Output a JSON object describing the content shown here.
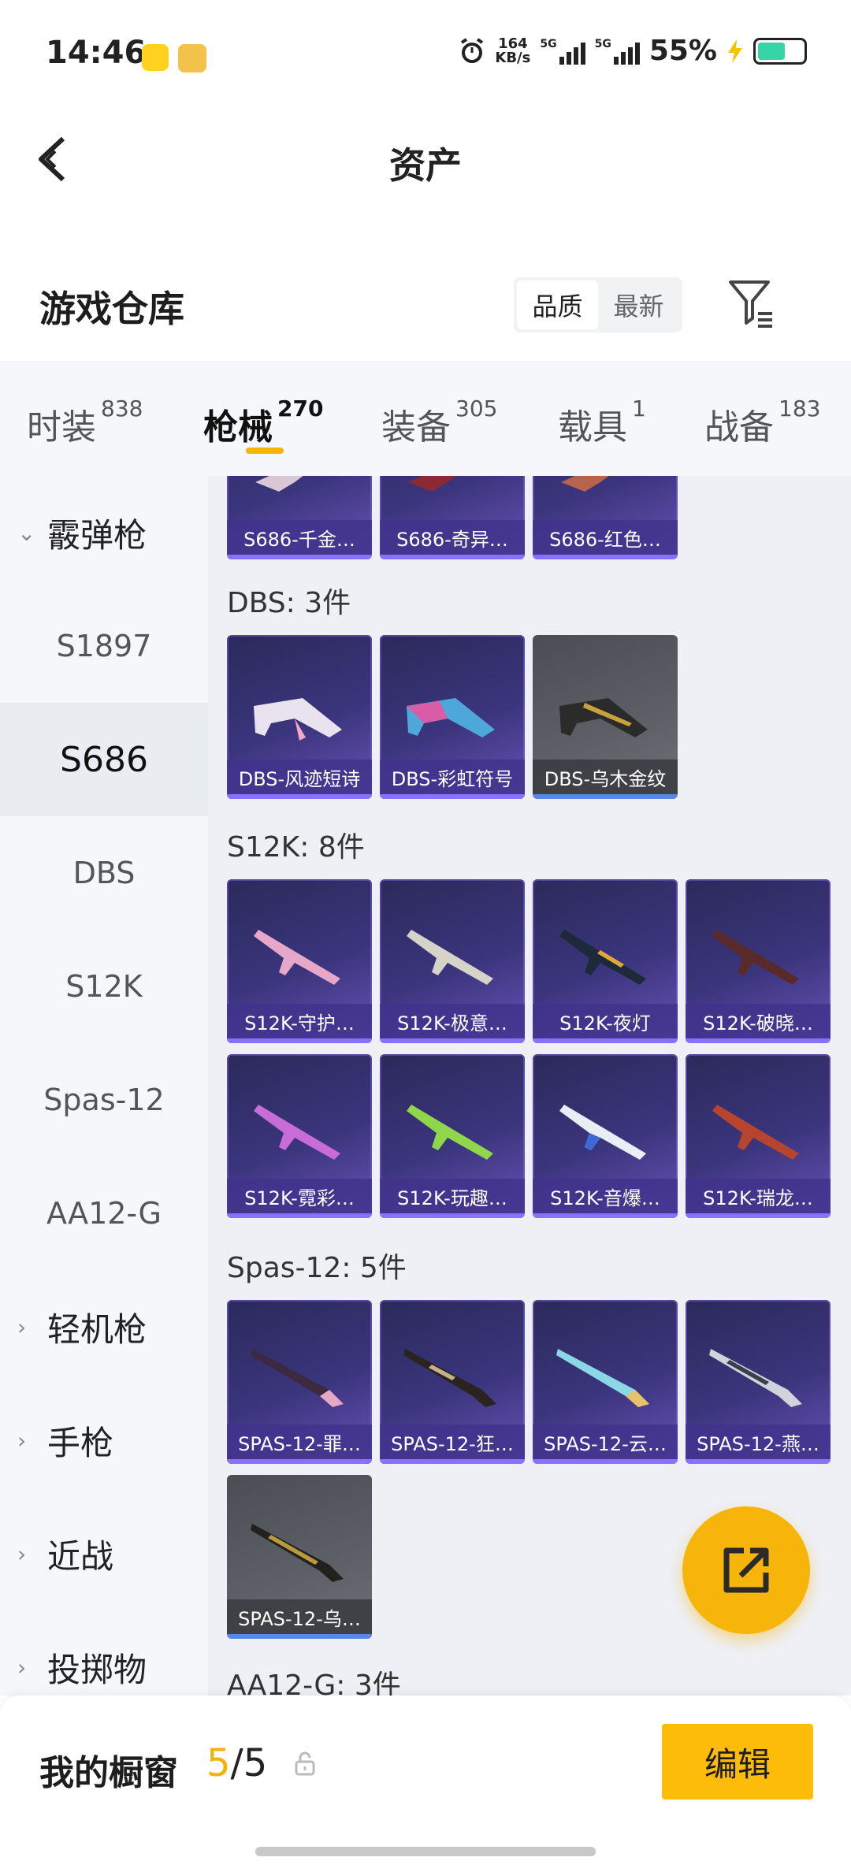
{
  "status": {
    "time": "14:46",
    "speed": "164",
    "speed_unit": "KB/s",
    "net1": "5G",
    "net2": "5G",
    "battery": "55%"
  },
  "header": {
    "title": "资产"
  },
  "repo": {
    "title": "游戏仓库",
    "sort_quality": "品质",
    "sort_latest": "最新"
  },
  "tabs": [
    {
      "label": "时装",
      "count": "838"
    },
    {
      "label": "枪械",
      "count": "270"
    },
    {
      "label": "装备",
      "count": "305"
    },
    {
      "label": "载具",
      "count": "1"
    },
    {
      "label": "战备",
      "count": "183"
    }
  ],
  "sidebar": {
    "category_shotgun": "霰弹枪",
    "items": [
      "S1897",
      "S686",
      "DBS",
      "S12K",
      "Spas-12",
      "AA12-G"
    ],
    "selected": "S686",
    "cat_lmg": "轻机枪",
    "cat_pistol": "手枪",
    "cat_melee": "近战",
    "cat_throw": "投掷物"
  },
  "content": {
    "s686_cards": [
      "S686-千金…",
      "S686-奇异…",
      "S686-红色…"
    ],
    "dbs_label": "DBS: 3件",
    "dbs_cards": [
      "DBS-风迹短诗",
      "DBS-彩虹符号",
      "DBS-乌木金纹"
    ],
    "s12k_label": "S12K: 8件",
    "s12k_cards": [
      "S12K-守护…",
      "S12K-极意…",
      "S12K-夜灯",
      "S12K-破晓…",
      "S12K-霓彩…",
      "S12K-玩趣…",
      "S12K-音爆…",
      "S12K-瑞龙…"
    ],
    "spas_label": "Spas-12: 5件",
    "spas_cards": [
      "SPAS-12-罪…",
      "SPAS-12-狂…",
      "SPAS-12-云…",
      "SPAS-12-燕…",
      "SPAS-12-乌…"
    ],
    "aa12_label": "AA12-G: 3件"
  },
  "bottom": {
    "label": "我的橱窗",
    "used": "5",
    "total": "/5",
    "edit": "编辑"
  },
  "colors": {
    "accent": "#fdbb0a",
    "fab": "#f7b40b",
    "card_purple": "#3b357d"
  }
}
